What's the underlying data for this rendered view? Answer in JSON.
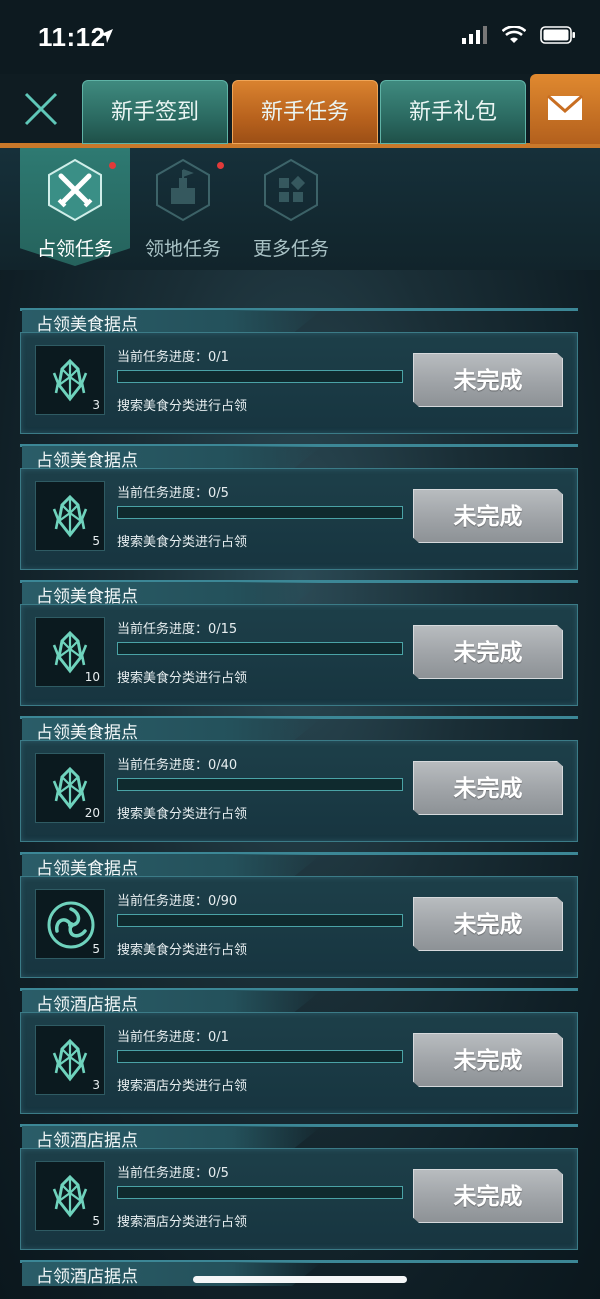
{
  "status_bar": {
    "time": "11:12"
  },
  "top_tabs": [
    {
      "label": "新手签到",
      "active": false
    },
    {
      "label": "新手任务",
      "active": true
    },
    {
      "label": "新手礼包",
      "active": false
    }
  ],
  "subtabs": [
    {
      "label": "占领任务",
      "active": true,
      "has_dot": true
    },
    {
      "label": "领地任务",
      "active": false,
      "has_dot": true
    },
    {
      "label": "更多任务",
      "active": false,
      "has_dot": false
    }
  ],
  "tasks": [
    {
      "title": "占领美食据点",
      "icon": "crystal-icon",
      "count": "3",
      "progress_label": "当前任务进度：0/1",
      "progress": 0,
      "desc": "搜索美食分类进行占领",
      "status": "未完成"
    },
    {
      "title": "占领美食据点",
      "icon": "crystal-icon",
      "count": "5",
      "progress_label": "当前任务进度：0/5",
      "progress": 0,
      "desc": "搜索美食分类进行占领",
      "status": "未完成"
    },
    {
      "title": "占领美食据点",
      "icon": "crystal-icon",
      "count": "10",
      "progress_label": "当前任务进度：0/15",
      "progress": 0,
      "desc": "搜索美食分类进行占领",
      "status": "未完成"
    },
    {
      "title": "占领美食据点",
      "icon": "crystal-icon",
      "count": "20",
      "progress_label": "当前任务进度：0/40",
      "progress": 0,
      "desc": "搜索美食分类进行占领",
      "status": "未完成"
    },
    {
      "title": "占领美食据点",
      "icon": "swirl-emblem-icon",
      "count": "5",
      "progress_label": "当前任务进度：0/90",
      "progress": 0,
      "desc": "搜索美食分类进行占领",
      "status": "未完成"
    },
    {
      "title": "占领酒店据点",
      "icon": "crystal-icon",
      "count": "3",
      "progress_label": "当前任务进度：0/1",
      "progress": 0,
      "desc": "搜索酒店分类进行占领",
      "status": "未完成"
    },
    {
      "title": "占领酒店据点",
      "icon": "crystal-icon",
      "count": "5",
      "progress_label": "当前任务进度：0/5",
      "progress": 0,
      "desc": "搜索酒店分类进行占领",
      "status": "未完成"
    }
  ],
  "partial_task": {
    "title": "占领酒店据点"
  },
  "colors": {
    "accent_orange": "#c9782a",
    "accent_teal": "#3fb8a8",
    "red_dot": "#e23a3a"
  }
}
